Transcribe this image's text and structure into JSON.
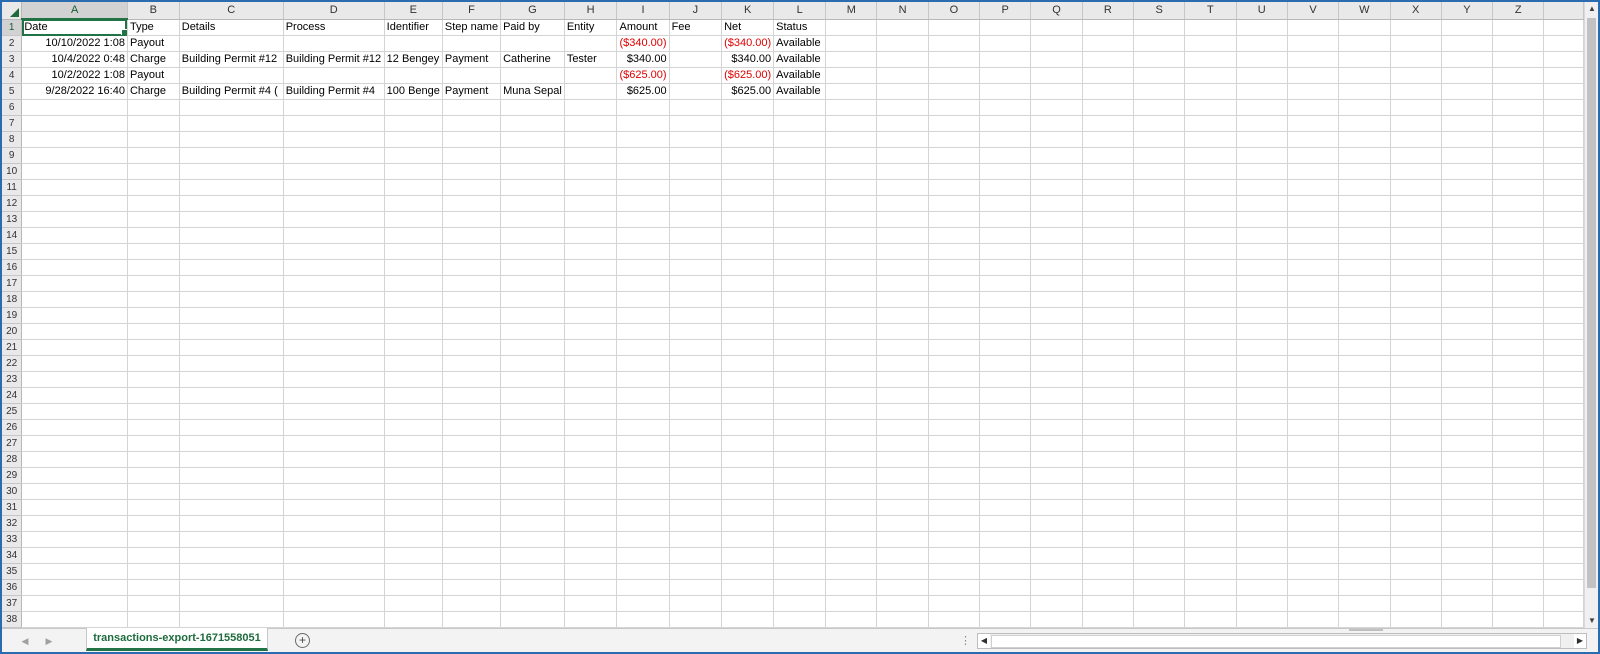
{
  "sheet": {
    "columns": [
      "A",
      "B",
      "C",
      "D",
      "E",
      "F",
      "G",
      "H",
      "I",
      "J",
      "K",
      "L",
      "M",
      "N",
      "O",
      "P",
      "Q",
      "R",
      "S",
      "T",
      "U",
      "V",
      "W",
      "X",
      "Y",
      "Z"
    ],
    "row_count": 38,
    "active_cell": "A1",
    "rows": [
      [
        "Date",
        "Type",
        "Details",
        "Process",
        "Identifier",
        "Step name",
        "Paid by",
        "Entity",
        "Amount",
        "Fee",
        "Net",
        "Status"
      ],
      [
        "10/10/2022 1:08",
        "Payout",
        "",
        "",
        "",
        "",
        "",
        "",
        "($340.00)",
        "",
        "($340.00)",
        "Available"
      ],
      [
        "10/4/2022 0:48",
        "Charge",
        "Building Permit #12",
        "Building Permit #12",
        "12 Bengey",
        "Payment",
        "Catherine",
        "Tester",
        "$340.00",
        "",
        "$340.00",
        "Available"
      ],
      [
        "10/2/2022 1:08",
        "Payout",
        "",
        "",
        "",
        "",
        "",
        "",
        "($625.00)",
        "",
        "($625.00)",
        "Available"
      ],
      [
        "9/28/2022 16:40",
        "Charge",
        "Building Permit #4 (",
        "Building Permit #4",
        "100 Benge",
        "Payment",
        "Muna Sepal",
        "",
        "$625.00",
        "",
        "$625.00",
        "Available"
      ]
    ]
  },
  "tabs": {
    "active_tab": "transactions-export-1671558051",
    "add_sheet_symbol": "+"
  },
  "scroll": {
    "split_symbol": "⋮"
  },
  "colors": {
    "negative": "#e00000",
    "accent": "#217346"
  }
}
